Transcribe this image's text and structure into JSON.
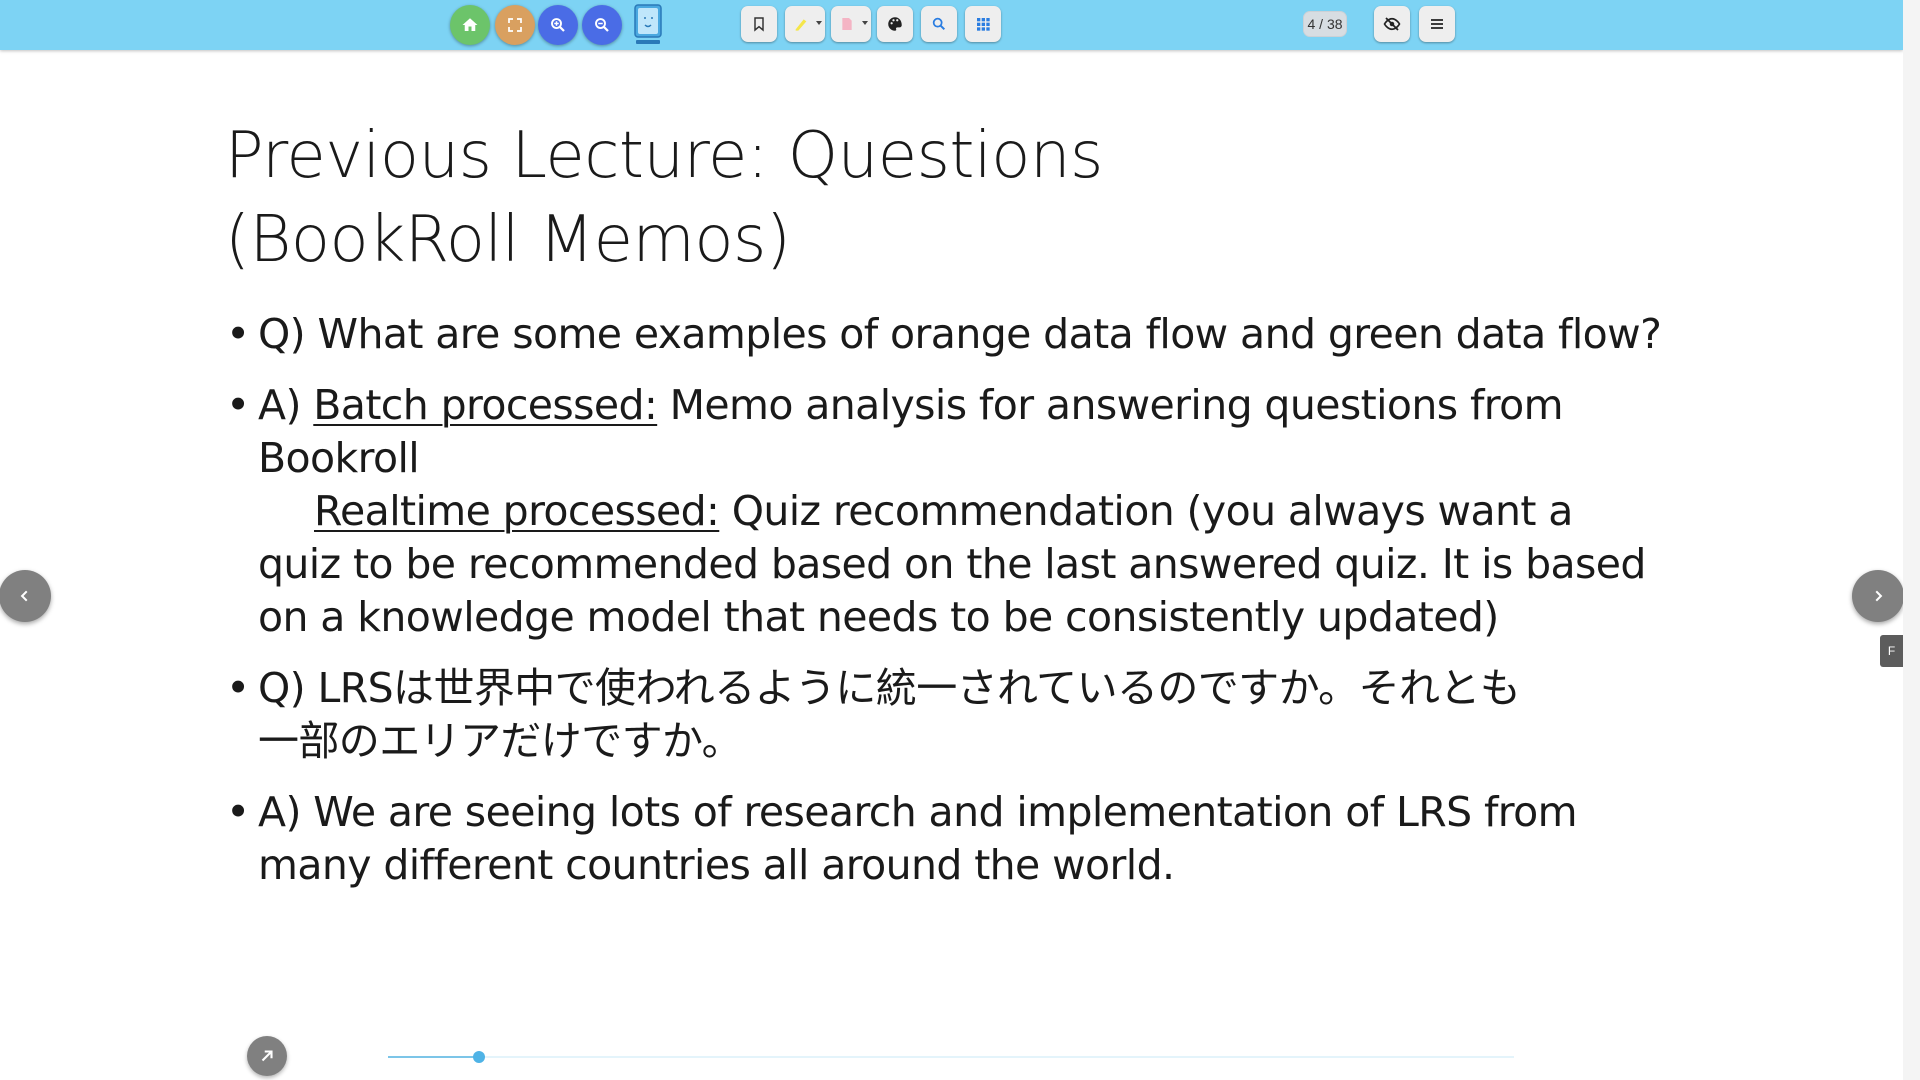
{
  "toolbar": {
    "home_icon": "home-icon",
    "fullscreen_icon": "fullscreen-icon",
    "zoom_in_icon": "zoom-in-icon",
    "zoom_out_icon": "zoom-out-icon",
    "logo_icon": "app-logo",
    "bookmark_icon": "bookmark-icon",
    "highlighter_icon": "highlighter-icon",
    "memo_icon": "memo-icon",
    "palette_icon": "palette-icon",
    "search_icon": "search-icon",
    "grid_icon": "grid-icon",
    "hide_icon": "eye-off-icon",
    "menu_icon": "menu-icon",
    "page_indicator": "4 / 38",
    "colors": {
      "bar": "#7dd3f4",
      "home": "#6cc46a",
      "fullscreen": "#d9a060",
      "zoom": "#4a6ce6"
    }
  },
  "slide": {
    "title_line1": "Previous Lecture: Questions",
    "title_line2": "(BookRoll Memos)",
    "bullets": [
      {
        "line1": "Q) What are some examples of orange data flow and green data flow?"
      },
      {
        "prefix": "A) ",
        "batch_label": "Batch processed:",
        "batch_text": " Memo analysis for answering questions from",
        "batch_text_line2": "Bookroll",
        "realtime_label": "Realtime processed:",
        "realtime_text": " Quiz recommendation (you always want a",
        "realtime_line2": "quiz to be recommended based on the last answered quiz. It is based",
        "realtime_line3": "on a knowledge model that needs to be consistently updated)"
      },
      {
        "line1": "Q) LRSは世界中で使われるように統一されているのですか。それとも",
        "line2": "一部のエリアだけですか。"
      },
      {
        "line1": "A) We are seeing lots of research and implementation of LRS from",
        "line2": "many different countries all around the world."
      }
    ]
  },
  "navigation": {
    "prev_icon": "chevron-left-icon",
    "next_icon": "chevron-right-icon",
    "side_tab_label": "F",
    "expand_icon": "arrow-up-right-icon",
    "progress_fraction": 0.0811
  }
}
